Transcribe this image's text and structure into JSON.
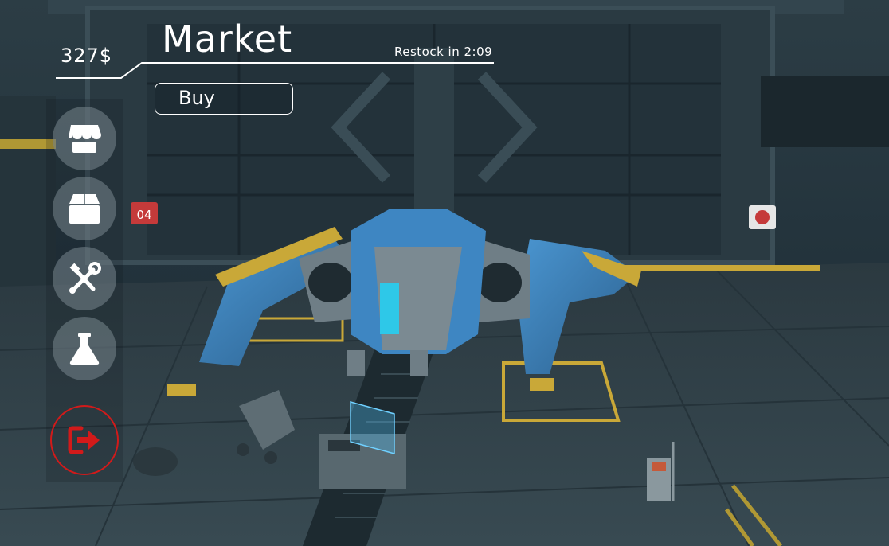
{
  "hud": {
    "money": "327$",
    "title": "Market",
    "restock": "Restock in 2:09",
    "buy_label": "Buy"
  },
  "side_menu": [
    {
      "name": "market",
      "icon": "store-icon"
    },
    {
      "name": "inventory",
      "icon": "box-icon"
    },
    {
      "name": "upgrades",
      "icon": "tools-icon"
    },
    {
      "name": "research",
      "icon": "flask-icon"
    }
  ],
  "exit": {
    "icon": "exit-icon"
  },
  "scene": {
    "bay_sign_left": "04"
  },
  "colors": {
    "hud_text": "#ffffff",
    "exit_accent": "#d21a1a",
    "ship_blue": "#3e86c2",
    "ship_grey": "#7b8a92",
    "hazard_yellow": "#d8b23a",
    "hangar_dark": "#1b2a33"
  }
}
